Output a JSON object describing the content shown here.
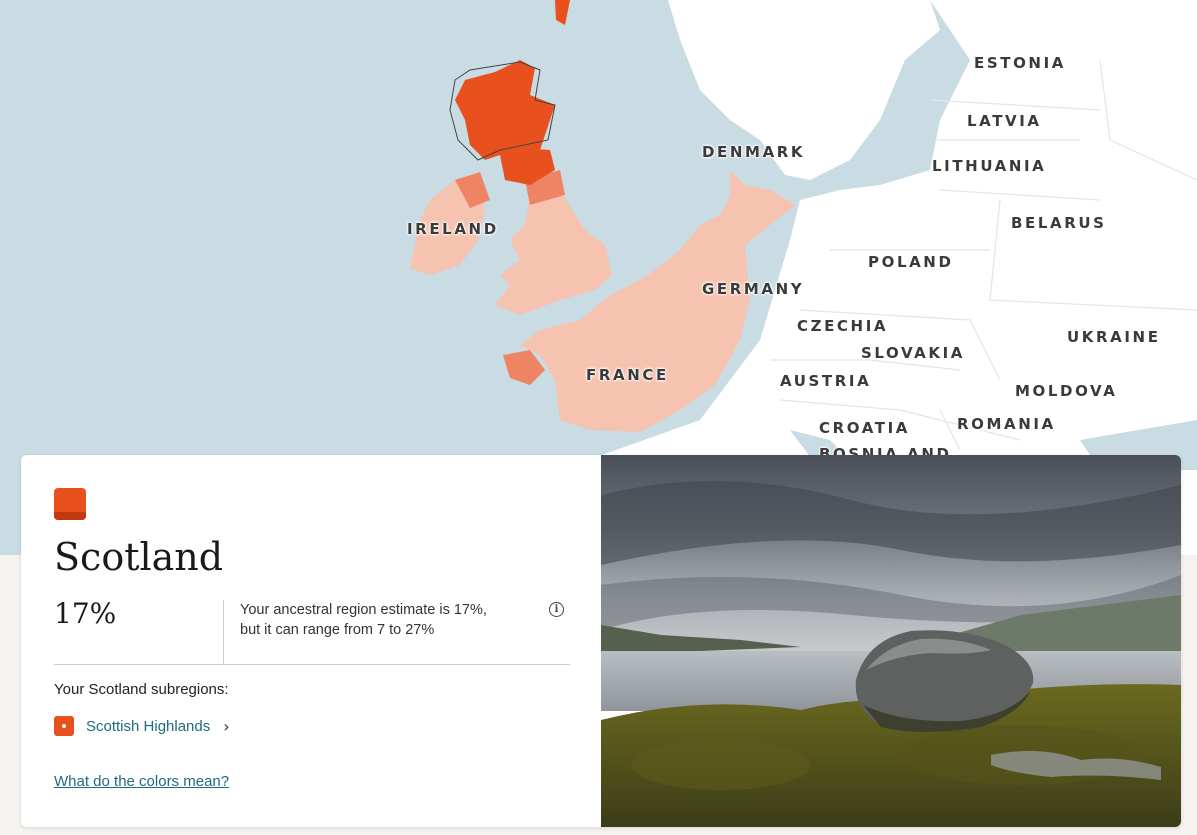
{
  "map": {
    "countries": [
      {
        "id": "estonia",
        "label": "ESTONIA"
      },
      {
        "id": "latvia",
        "label": "LATVIA"
      },
      {
        "id": "denmark",
        "label": "DENMARK"
      },
      {
        "id": "lithuania",
        "label": "LITHUANIA"
      },
      {
        "id": "belarus",
        "label": "BELARUS"
      },
      {
        "id": "ireland",
        "label": "IRELAND"
      },
      {
        "id": "poland",
        "label": "POLAND"
      },
      {
        "id": "germany",
        "label": "GERMANY"
      },
      {
        "id": "czechia",
        "label": "CZECHIA"
      },
      {
        "id": "ukraine",
        "label": "UKRAINE"
      },
      {
        "id": "slovakia",
        "label": "SLOVAKIA"
      },
      {
        "id": "france",
        "label": "FRANCE"
      },
      {
        "id": "austria",
        "label": "AUSTRIA"
      },
      {
        "id": "moldova",
        "label": "MOLDOVA"
      },
      {
        "id": "croatia",
        "label": "CROATIA"
      },
      {
        "id": "romania",
        "label": "ROMANIA"
      },
      {
        "id": "bosnia",
        "label": "BOSNIA AND"
      }
    ],
    "colors": {
      "sea": "#c9dbe3",
      "land": "#ffffff",
      "highlight_strong": "#e8501e",
      "highlight_medium": "#ef8464",
      "highlight_light": "#f6c3b0"
    }
  },
  "region_card": {
    "swatch_color": "#e8501e",
    "title": "Scotland",
    "percent": "17%",
    "estimate_line1": "Your ancestral region estimate is 17%,",
    "estimate_line2": "but it can range from 7 to 27%",
    "info_icon": "info-icon",
    "subregions_heading": "Your Scotland subregions:",
    "subregions": [
      {
        "label": "Scottish Highlands",
        "icon": "chevron-right-icon"
      }
    ],
    "colors_link": "What do the colors mean?"
  }
}
